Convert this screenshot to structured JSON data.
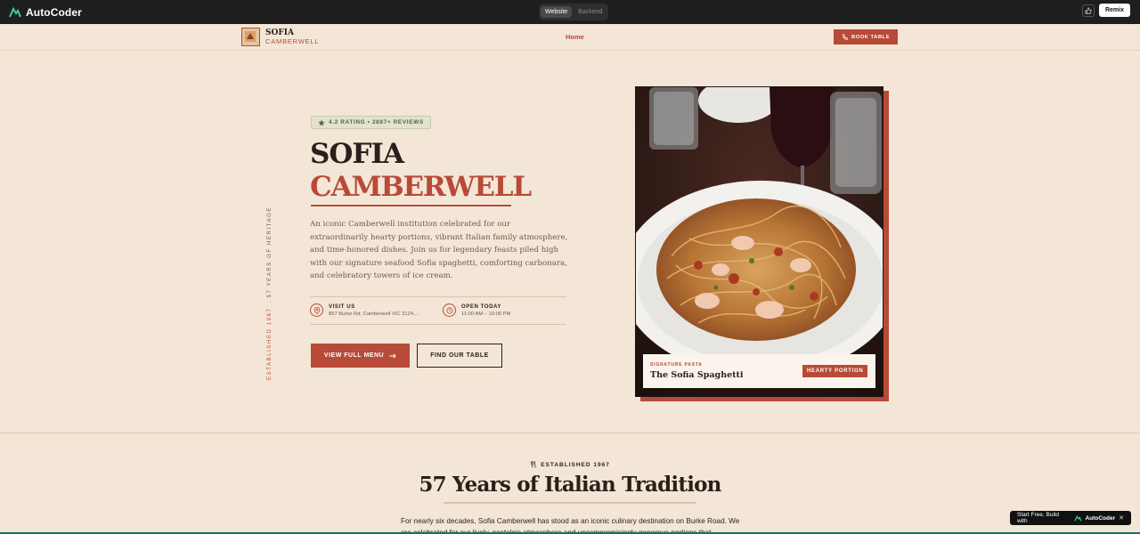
{
  "appbar": {
    "brand": "AutoCoder",
    "tabs": [
      "Website",
      "Backend"
    ],
    "active_tab": "Website",
    "remix_label": "Remix"
  },
  "nav": {
    "logo_line1": "SOFIA",
    "logo_line2": "CAMBERWELL",
    "home_label": "Home",
    "book_label": "BOOK TABLE"
  },
  "hero": {
    "vertical_established": "ESTABLISHED 1967",
    "vertical_years": "57 YEARS OF HERITAGE",
    "rating_badge": "4.2 RATING • 2887+ REVIEWS",
    "title_line1": "SOFIA",
    "title_line2": "CAMBERWELL",
    "description": "An iconic Camberwell institution celebrated for our extraordinarily hearty portions, vibrant Italian family atmosphere, and time-honored dishes. Join us for legendary feasts piled high with our signature seafood Sofia spaghetti, comforting carbonara, and celebratory towers of ice cream.",
    "visit_title": "VISIT US",
    "visit_sub": "857 Burke Rd, Camberwell VIC 3124,...",
    "open_title": "OPEN TODAY",
    "open_sub": "11:00 AM – 10:00 PM",
    "menu_button": "VIEW FULL MENU",
    "find_button": "FIND OUR TABLE",
    "caption_small": "SIGNATURE PASTA",
    "caption_title": "The Sofia Spaghetti",
    "caption_tag": "HEARTY PORTION"
  },
  "section2": {
    "label": "ESTABLISHED 1967",
    "title": "57 Years of Italian Tradition",
    "description": "For nearly six decades, Sofia Camberwell has stood as an iconic culinary destination on Burke Road. We are celebrated for our lively, nostalgic atmosphere and uncompromisingly generous portions that"
  },
  "float": {
    "label": "Start Free, Build with",
    "brand": "AutoCoder",
    "close": "✕"
  },
  "colors": {
    "accent": "#b84a38",
    "background": "#f3e6d6",
    "dark": "#2a1f1a",
    "rating_green": "#4c6b42"
  }
}
